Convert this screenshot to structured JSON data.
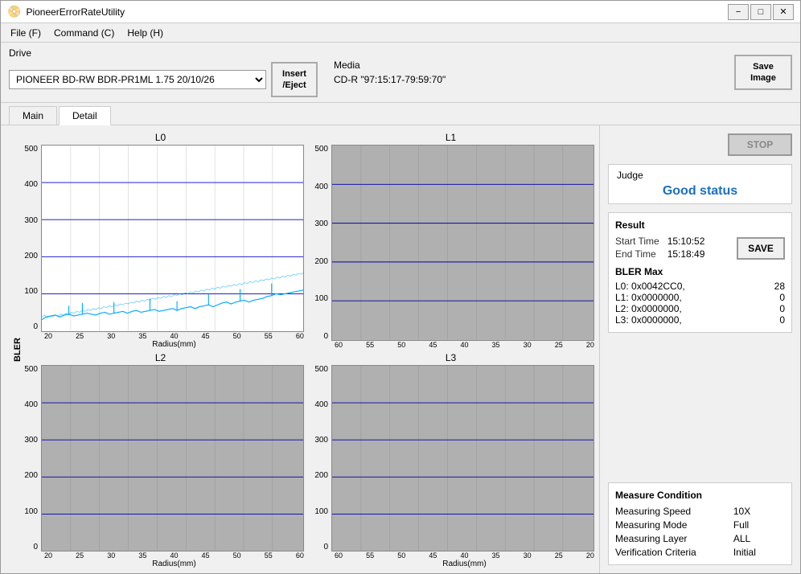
{
  "window": {
    "title": "PioneerErrorRateUtility"
  },
  "menu": {
    "file": "File (F)",
    "command": "Command (C)",
    "help": "Help (H)"
  },
  "toolbar": {
    "drive_label": "Drive",
    "drive_value": "PIONEER BD-RW BDR-PR1ML 1.75 20/10/26",
    "insert_eject": "Insert\n/Eject",
    "media_label": "Media",
    "media_value": "CD-R \"97:15:17-79:59:70\"",
    "save_image": "Save\nImage"
  },
  "tabs": {
    "main": "Main",
    "detail": "Detail"
  },
  "charts": {
    "bler_label": "BLER",
    "l0": {
      "title": "L0",
      "y_labels": [
        "500",
        "400",
        "300",
        "200",
        "100",
        "0"
      ],
      "x_labels": [
        "20",
        "25",
        "30",
        "35",
        "40",
        "45",
        "50",
        "55",
        "60"
      ],
      "x_axis_label": "Radius(mm)",
      "has_data": true
    },
    "l1": {
      "title": "L1",
      "y_labels": [
        "500",
        "400",
        "300",
        "200",
        "100",
        "0"
      ],
      "x_labels": [
        "60",
        "55",
        "50",
        "45",
        "40",
        "35",
        "30",
        "25",
        "20"
      ],
      "x_axis_label": "",
      "has_data": false
    },
    "l2": {
      "title": "L2",
      "y_labels": [
        "500",
        "400",
        "300",
        "200",
        "100",
        "0"
      ],
      "x_labels": [
        "20",
        "25",
        "30",
        "35",
        "40",
        "45",
        "50",
        "55",
        "60"
      ],
      "x_axis_label": "Radius(mm)",
      "has_data": false
    },
    "l3": {
      "title": "L3",
      "y_labels": [
        "500",
        "400",
        "300",
        "200",
        "100",
        "0"
      ],
      "x_labels": [
        "60",
        "55",
        "50",
        "45",
        "40",
        "35",
        "30",
        "25",
        "20"
      ],
      "x_axis_label": "Radius(mm)",
      "has_data": false
    }
  },
  "right_panel": {
    "stop_label": "STOP",
    "judge_label": "Judge",
    "judge_status": "Good status",
    "result_label": "Result",
    "start_time_label": "Start Time",
    "start_time_value": "15:10:52",
    "end_time_label": "End Time",
    "end_time_value": "15:18:49",
    "save_label": "SAVE",
    "bler_max_label": "BLER Max",
    "bler_l0": "L0: 0x0042CC0,",
    "bler_l0_val": "28",
    "bler_l1": "L1: 0x0000000,",
    "bler_l1_val": "0",
    "bler_l2": "L2: 0x0000000,",
    "bler_l2_val": "0",
    "bler_l3": "L3: 0x0000000,",
    "bler_l3_val": "0",
    "measure_label": "Measure Condition",
    "measuring_speed_label": "Measuring Speed",
    "measuring_speed_value": "10X",
    "measuring_mode_label": "Measuring Mode",
    "measuring_mode_value": "Full",
    "measuring_layer_label": "Measuring Layer",
    "measuring_layer_value": "ALL",
    "verification_criteria_label": "Verification Criteria",
    "verification_criteria_value": "Initial"
  }
}
